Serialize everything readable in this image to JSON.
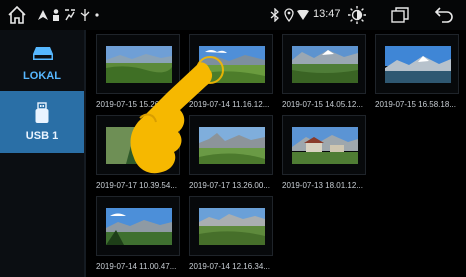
{
  "statusbar": {
    "time": "13:47"
  },
  "sidebar": {
    "items": [
      {
        "label": "LOKAL",
        "icon": "hard-drive-icon",
        "active": false
      },
      {
        "label": "USB 1",
        "icon": "usb-icon",
        "active": true
      }
    ]
  },
  "gallery": {
    "items": [
      {
        "caption": "2019-07-15 15.26..."
      },
      {
        "caption": "2019-07-14 11.16.12..."
      },
      {
        "caption": "2019-07-15 14.05.12..."
      },
      {
        "caption": "2019-07-15 16.58.18..."
      },
      {
        "caption": "2019-07-17 10.39.54..."
      },
      {
        "caption": "2019-07-17 13.26.00..."
      },
      {
        "caption": "2019-07-13 18.01.12..."
      },
      {
        "caption": "2019-07-14 11.00.47..."
      },
      {
        "caption": "2019-07-14 12.16.34..."
      }
    ]
  },
  "colors": {
    "accent": "#2a6fa6",
    "accent_text": "#56b7ff",
    "hand": "#f6b800"
  }
}
